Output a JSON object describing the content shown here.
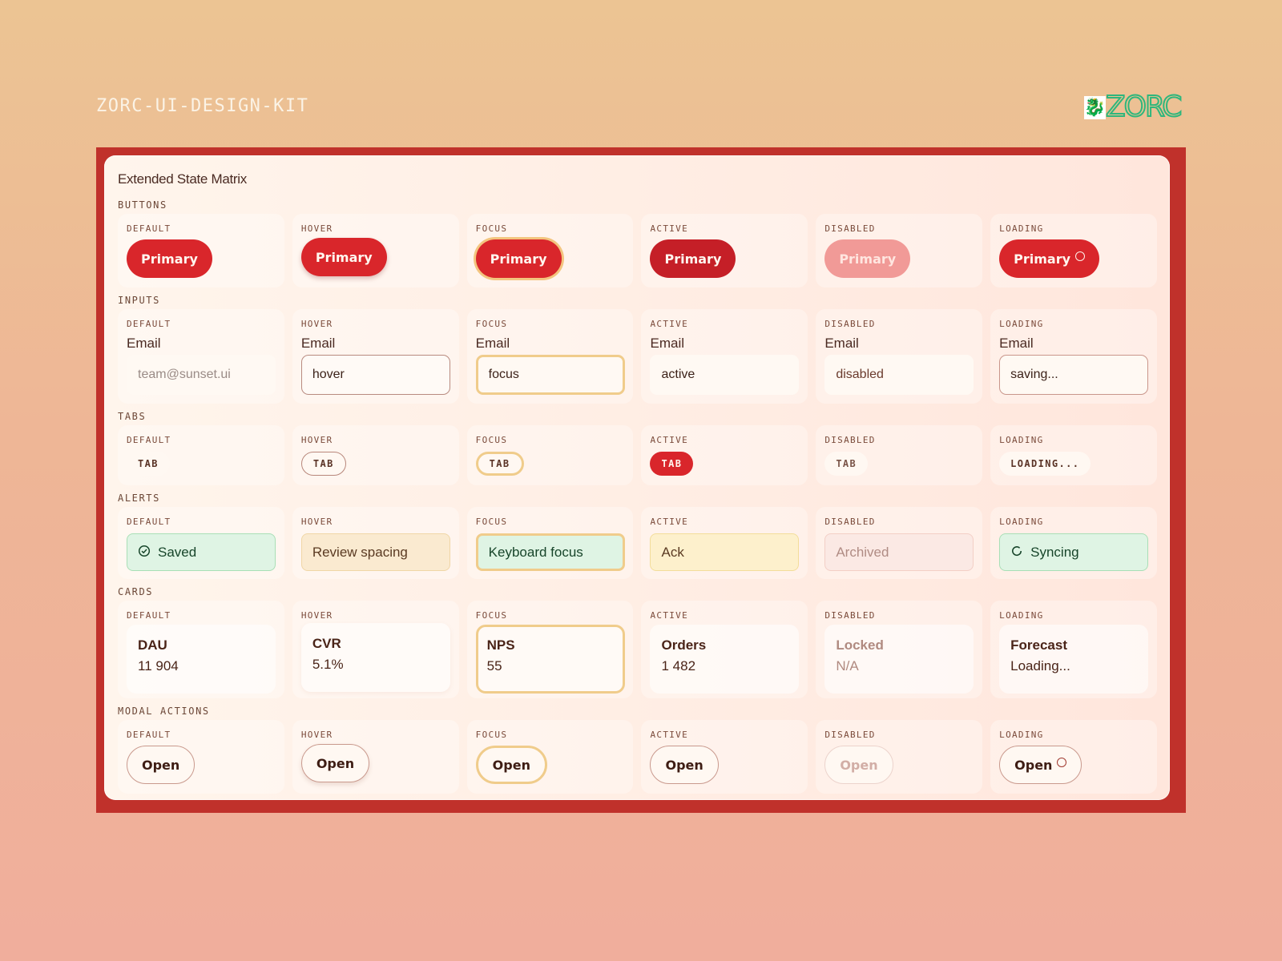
{
  "page": {
    "kit_title": "ZORC-UI-DESIGN-KIT",
    "logo_text": "ZORC",
    "logo_icon": "dragon-mascot-icon",
    "accent_color": "#d9262b",
    "logo_color": "#2fb67c"
  },
  "panel": {
    "title": "Extended State Matrix"
  },
  "states": [
    "DEFAULT",
    "HOVER",
    "FOCUS",
    "ACTIVE",
    "DISABLED",
    "LOADING"
  ],
  "sections": {
    "buttons": {
      "label": "BUTTONS",
      "items": [
        "Primary",
        "Primary",
        "Primary",
        "Primary",
        "Primary",
        "Primary"
      ]
    },
    "inputs": {
      "label": "INPUTS",
      "field_label": "Email",
      "placeholder": "team@sunset.ui",
      "values": [
        "",
        "hover",
        "focus",
        "active",
        "disabled",
        "saving..."
      ]
    },
    "tabs": {
      "label": "TABS",
      "items": [
        "TAB",
        "TAB",
        "TAB",
        "TAB",
        "TAB",
        "LOADING..."
      ]
    },
    "alerts": {
      "label": "ALERTS",
      "items": [
        "Saved",
        "Review spacing",
        "Keyboard focus",
        "Ack",
        "Archived",
        "Syncing"
      ],
      "icons": [
        "check-circle-icon",
        "",
        "",
        "",
        "",
        "sync-icon"
      ]
    },
    "cards": {
      "label": "CARDS",
      "items": [
        {
          "title": "DAU",
          "value": "11 904"
        },
        {
          "title": "CVR",
          "value": "5.1%"
        },
        {
          "title": "NPS",
          "value": "55"
        },
        {
          "title": "Orders",
          "value": "1 482"
        },
        {
          "title": "Locked",
          "value": "N/A"
        },
        {
          "title": "Forecast",
          "value": "Loading..."
        }
      ]
    },
    "modal_actions": {
      "label": "MODAL ACTIONS",
      "items": [
        "Open",
        "Open",
        "Open",
        "Open",
        "Open",
        "Open"
      ]
    }
  }
}
